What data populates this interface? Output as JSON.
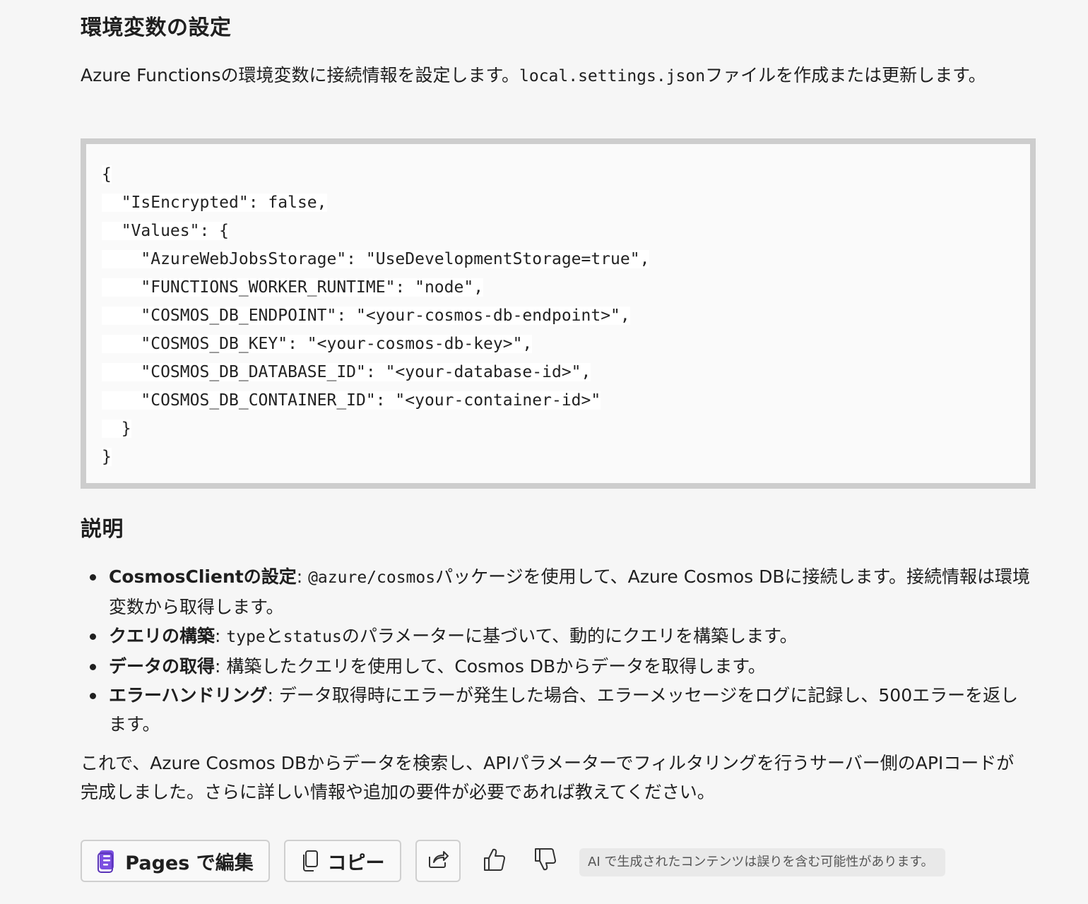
{
  "section1": {
    "heading": "環境変数の設定",
    "intro_before": "Azure Functionsの環境変数に接続情報を設定します。",
    "intro_code": "local.settings.json",
    "intro_after": "ファイルを作成または更新します。"
  },
  "code_lines": [
    "{",
    "  \"IsEncrypted\": false,",
    "  \"Values\": {",
    "    \"AzureWebJobsStorage\": \"UseDevelopmentStorage=true\",",
    "    \"FUNCTIONS_WORKER_RUNTIME\": \"node\",",
    "    \"COSMOS_DB_ENDPOINT\": \"<your-cosmos-db-endpoint>\",",
    "    \"COSMOS_DB_KEY\": \"<your-cosmos-db-key>\",",
    "    \"COSMOS_DB_DATABASE_ID\": \"<your-database-id>\",",
    "    \"COSMOS_DB_CONTAINER_ID\": \"<your-container-id>\"",
    "  }",
    "}"
  ],
  "section2": {
    "heading": "説明",
    "bullets": [
      {
        "title": "CosmosClientの設定",
        "colon": ": ",
        "code1": "@azure/cosmos",
        "text1": "パッケージを使用して、Azure Cosmos DBに接続します。接続情報は環境変数から取得します。"
      },
      {
        "title": "クエリの構築",
        "colon": ": ",
        "code1": "type",
        "mid": "と",
        "code2": "status",
        "text1": "のパラメーターに基づいて、動的にクエリを構築します。"
      },
      {
        "title": "データの取得",
        "colon": ": ",
        "text1": "構築したクエリを使用して、Cosmos DBからデータを取得します。"
      },
      {
        "title": "エラーハンドリング",
        "colon": ": ",
        "text1": "データ取得時にエラーが発生した場合、エラーメッセージをログに記録し、500エラーを返します。"
      }
    ],
    "outro": "これで、Azure Cosmos DBからデータを検索し、APIパラメーターでフィルタリングを行うサーバー側のAPIコードが完成しました。さらに詳しい情報や追加の要件が必要であれば教えてください。"
  },
  "actions": {
    "pages_label": "Pages で編集",
    "copy_label": "コピー",
    "disclaimer": "AI で生成されたコンテンツは誤りを含む可能性があります。"
  },
  "icons": {
    "pages": "pages-icon",
    "copy": "copy-icon",
    "share": "share-icon",
    "like": "thumbs-up-icon",
    "dislike": "thumbs-down-icon"
  },
  "colors": {
    "pages_icon": "#7b4fe0",
    "code_border": "#cdcdcd",
    "background": "#f6f6f6"
  }
}
